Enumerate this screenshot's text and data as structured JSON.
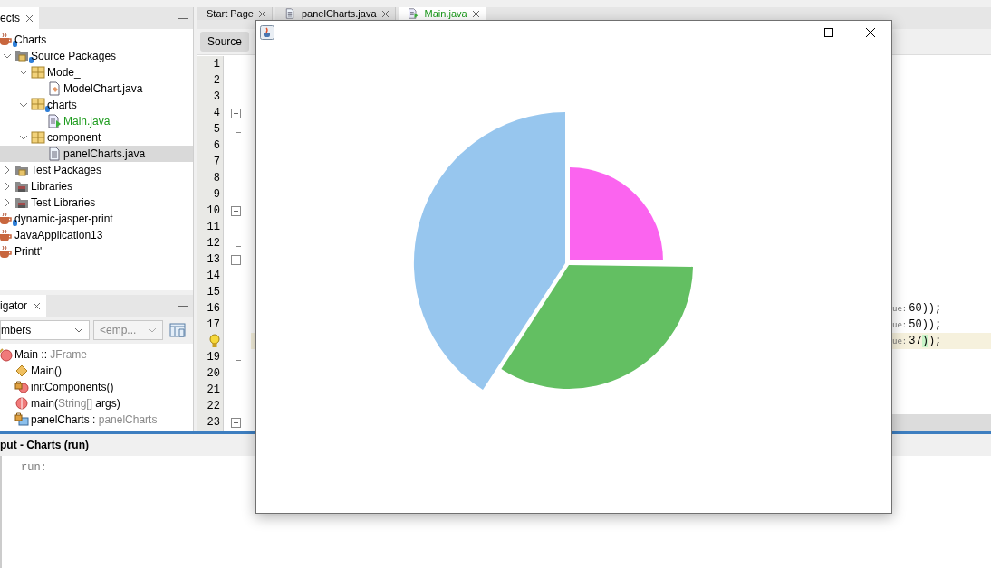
{
  "projects_panel": {
    "tab": {
      "label": "ects",
      "selected": true
    },
    "tree": [
      {
        "label": "Charts",
        "kind": "project",
        "versioned": true,
        "selected": false,
        "children": [
          {
            "label": "Source Packages",
            "kind": "source-folder",
            "versioned": true,
            "selected": false,
            "expanded": true,
            "children": [
              {
                "label": "Mode_",
                "kind": "package",
                "versioned": false,
                "selected": false,
                "expanded": true,
                "children": [
                  {
                    "label": "ModelChart.java",
                    "kind": "class-file",
                    "versioned": false,
                    "selected": false,
                    "added": false
                  }
                ]
              },
              {
                "label": "charts",
                "kind": "package",
                "versioned": true,
                "selected": false,
                "expanded": true,
                "children": [
                  {
                    "label": "Main.java",
                    "kind": "main-file",
                    "versioned": false,
                    "selected": false,
                    "added": true
                  }
                ]
              },
              {
                "label": "component",
                "kind": "package",
                "versioned": false,
                "selected": false,
                "expanded": true,
                "children": [
                  {
                    "label": "panelCharts.java",
                    "kind": "form-file",
                    "versioned": false,
                    "selected": true,
                    "added": false
                  }
                ]
              }
            ]
          },
          {
            "label": "Test Packages",
            "kind": "test-folder",
            "versioned": false,
            "selected": false,
            "expanded": false
          },
          {
            "label": "Libraries",
            "kind": "library",
            "versioned": false,
            "selected": false,
            "expanded": false
          },
          {
            "label": "Test Libraries",
            "kind": "library",
            "versioned": false,
            "selected": false,
            "expanded": false
          }
        ]
      },
      {
        "label": "dynamic-jasper-print",
        "kind": "project",
        "versioned": true,
        "selected": false
      },
      {
        "label": "JavaApplication13",
        "kind": "project",
        "versioned": false,
        "selected": false
      },
      {
        "label": "Printt'",
        "kind": "project",
        "versioned": false,
        "selected": false
      }
    ]
  },
  "navigator_panel": {
    "tab": {
      "label": "igator",
      "selected": true
    },
    "filter": {
      "value": "mbers"
    },
    "scope": {
      "value": "<emp...",
      "disabled": true
    },
    "members": [
      {
        "kind": "class",
        "parts": [
          {
            "text": "Main :: ",
            "muted": false
          },
          {
            "text": "JFrame",
            "muted": true
          }
        ],
        "children": [
          {
            "kind": "constructor",
            "parts": [
              {
                "text": "Main()",
                "muted": false
              }
            ]
          },
          {
            "kind": "private-method",
            "parts": [
              {
                "text": "initComponents()",
                "muted": false
              }
            ]
          },
          {
            "kind": "static-method",
            "parts": [
              {
                "text": "main(",
                "muted": false
              },
              {
                "text": "String[]",
                "muted": true
              },
              {
                "text": " args)",
                "muted": false
              }
            ]
          },
          {
            "kind": "private-field",
            "parts": [
              {
                "text": "panelCharts : ",
                "muted": false
              },
              {
                "text": "panelCharts",
                "muted": true
              }
            ]
          }
        ]
      }
    ]
  },
  "editor": {
    "tabs": [
      {
        "label": "Start Page",
        "selected": false,
        "added": false
      },
      {
        "label": "panelCharts.java",
        "selected": false,
        "added": false
      },
      {
        "label": "Main.java",
        "selected": true,
        "added": true
      }
    ],
    "view_buttons": [
      {
        "label": "Source",
        "selected": true
      }
    ],
    "lines": [
      {
        "number": "1"
      },
      {
        "number": "2"
      },
      {
        "number": "3"
      },
      {
        "number": "4",
        "fold": {
          "kind": "start"
        }
      },
      {
        "number": "5",
        "fold": {
          "kind": "end"
        }
      },
      {
        "number": "6"
      },
      {
        "number": "7"
      },
      {
        "number": "8"
      },
      {
        "number": "9"
      },
      {
        "number": "10",
        "fold": {
          "kind": "start"
        }
      },
      {
        "number": "11",
        "fold": {
          "kind": "mid"
        }
      },
      {
        "number": "12",
        "fold": {
          "kind": "end"
        }
      },
      {
        "number": "13",
        "fold": {
          "kind": "start"
        }
      },
      {
        "number": "14",
        "fold": {
          "kind": "mid"
        }
      },
      {
        "number": "15",
        "fold": {
          "kind": "mid"
        }
      },
      {
        "number": "16",
        "fold": {
          "kind": "mid"
        },
        "hint": "ue:",
        "tail": [
          {
            "text": "60));",
            "match": false
          }
        ]
      },
      {
        "number": "17",
        "fold": {
          "kind": "mid"
        },
        "hint": "ue:",
        "tail": [
          {
            "text": "50));",
            "match": false
          }
        ]
      },
      {
        "kind": "bulb",
        "fold": {
          "kind": "mid"
        },
        "highlighted": true,
        "hint": "ue:",
        "tail": [
          {
            "text": "37",
            "match": false
          },
          {
            "text": ")",
            "match": true
          },
          {
            "text": ");",
            "match": false
          }
        ]
      },
      {
        "number": "19",
        "fold": {
          "kind": "end"
        }
      },
      {
        "number": "20"
      },
      {
        "number": "21"
      },
      {
        "number": "22"
      },
      {
        "number": "23",
        "fold": {
          "kind": "collapsed"
        }
      }
    ]
  },
  "output_panel": {
    "title": "put - Charts (run)",
    "lines": [
      "run:"
    ]
  },
  "app_window": {
    "controls": [
      {
        "kind": "minimize"
      },
      {
        "kind": "maximize"
      },
      {
        "kind": "close"
      }
    ]
  }
}
